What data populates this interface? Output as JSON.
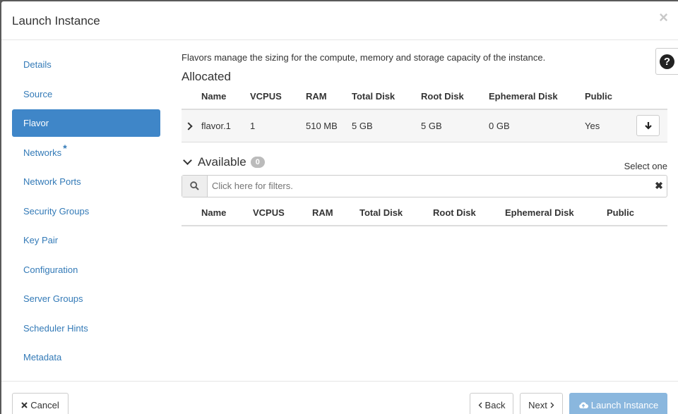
{
  "modal": {
    "title": "Launch Instance"
  },
  "sidebar": {
    "items": [
      {
        "label": "Details"
      },
      {
        "label": "Source"
      },
      {
        "label": "Flavor"
      },
      {
        "label": "Networks"
      },
      {
        "label": "Network Ports"
      },
      {
        "label": "Security Groups"
      },
      {
        "label": "Key Pair"
      },
      {
        "label": "Configuration"
      },
      {
        "label": "Server Groups"
      },
      {
        "label": "Scheduler Hints"
      },
      {
        "label": "Metadata"
      }
    ],
    "required_marker": "*"
  },
  "content": {
    "help_text": "Flavors manage the sizing for the compute, memory and storage capacity of the instance.",
    "allocated_title": "Allocated",
    "available_title": "Available",
    "available_count": "0",
    "select_one": "Select one",
    "columns": [
      "Name",
      "VCPUS",
      "RAM",
      "Total Disk",
      "Root Disk",
      "Ephemeral Disk",
      "Public"
    ],
    "allocated_rows": [
      {
        "name": "flavor.1",
        "vcpus": "1",
        "ram": "510 MB",
        "total_disk": "5 GB",
        "root_disk": "5 GB",
        "ephemeral_disk": "0 GB",
        "public": "Yes"
      }
    ],
    "filter_placeholder": "Click here for filters."
  },
  "footer": {
    "cancel": "Cancel",
    "back": "Back",
    "next": "Next",
    "launch": "Launch Instance"
  },
  "colors": {
    "active_nav": "#3f86c8",
    "link": "#337ab7",
    "launch_disabled": "#8ab7de"
  }
}
